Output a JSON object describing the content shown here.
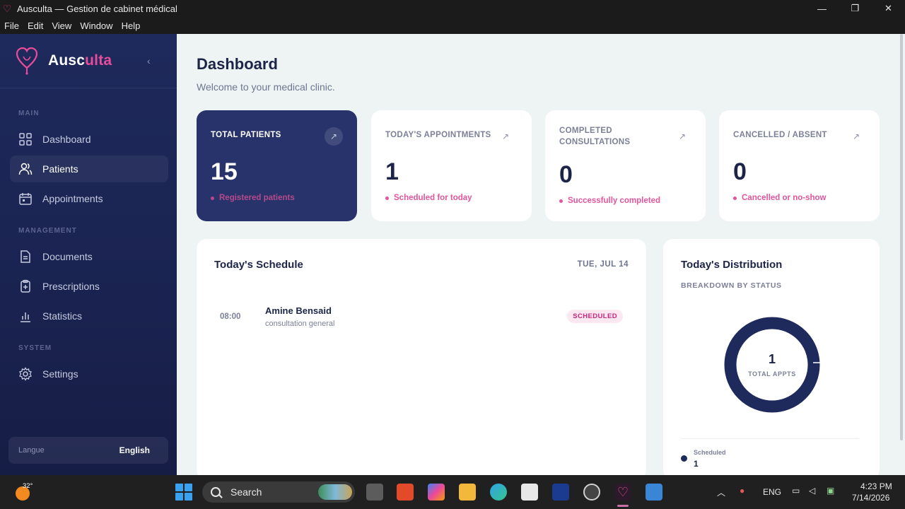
{
  "window": {
    "title": "Ausculta — Gestion de cabinet médical",
    "minimize": "—",
    "maximize": "❐",
    "close": "✕"
  },
  "menu": [
    "File",
    "Edit",
    "View",
    "Window",
    "Help"
  ],
  "brand": {
    "name_start": "Ausc",
    "name_accent": "ulta",
    "collapse_icon": "‹"
  },
  "sidebar": {
    "sections": {
      "main": "MAIN",
      "management": "MANAGEMENT",
      "system": "SYSTEM"
    },
    "items": [
      {
        "label": "Dashboard",
        "icon": "grid-icon"
      },
      {
        "label": "Patients",
        "icon": "users-icon"
      },
      {
        "label": "Appointments",
        "icon": "calendar-icon"
      },
      {
        "label": "Documents",
        "icon": "document-icon"
      },
      {
        "label": "Prescriptions",
        "icon": "clipboard-icon"
      },
      {
        "label": "Statistics",
        "icon": "bar-chart-icon"
      },
      {
        "label": "Settings",
        "icon": "gear-icon"
      }
    ],
    "language": {
      "label": "Langue",
      "value": "English"
    }
  },
  "header": {
    "title": "Dashboard",
    "subtitle": "Welcome to your medical clinic."
  },
  "stats": [
    {
      "label": "TOTAL PATIENTS",
      "value": "15",
      "note": "Registered patients"
    },
    {
      "label": "TODAY'S APPOINTMENTS",
      "value": "1",
      "note": "Scheduled for today"
    },
    {
      "label": "COMPLETED CONSULTATIONS",
      "value": "0",
      "note": "Successfully completed"
    },
    {
      "label": "CANCELLED / ABSENT",
      "value": "0",
      "note": "Cancelled or no-show"
    }
  ],
  "schedule": {
    "title": "Today's Schedule",
    "date": "TUE, JUL 14",
    "appointments": [
      {
        "time": "08:00",
        "name": "Amine Bensaid",
        "type": "consultation general",
        "status": "SCHEDULED"
      }
    ]
  },
  "distribution": {
    "title": "Today's Distribution",
    "subtitle": "BREAKDOWN BY STATUS",
    "total": "1",
    "total_label": "TOTAL APPTS",
    "legend": [
      {
        "name": "Scheduled",
        "value": "1",
        "color": "#1e2a5c"
      }
    ]
  },
  "taskbar": {
    "weather": "32°",
    "search": "Search",
    "language": "ENG",
    "time": "4:23 PM",
    "date": "7/14/2026"
  },
  "colors": {
    "accent": "#e84c9a",
    "navy": "#1e2a5c",
    "card_dark": "#27336a"
  }
}
